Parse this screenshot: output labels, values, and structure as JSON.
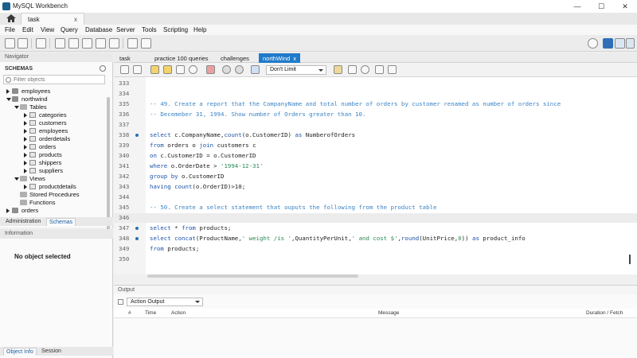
{
  "window": {
    "title": "MySQL Workbench",
    "controls": {
      "minimize": "—",
      "maximize": "☐",
      "close": "✕"
    }
  },
  "connection_tab": {
    "label": "task",
    "close": "x"
  },
  "menu": [
    "File",
    "Edit",
    "View",
    "Query",
    "Database",
    "Server",
    "Tools",
    "Scripting",
    "Help"
  ],
  "navigator": {
    "header": "Navigator",
    "schemas_title": "SCHEMAS",
    "filter_placeholder": "Filter objects",
    "tree": [
      {
        "label": "employees",
        "level": 0,
        "type": "db",
        "state": "collapsed"
      },
      {
        "label": "northwind",
        "level": 0,
        "type": "db",
        "state": "expanded"
      },
      {
        "label": "Tables",
        "level": 1,
        "type": "folder",
        "state": "expanded"
      },
      {
        "label": "categories",
        "level": 2,
        "type": "table",
        "state": "collapsed"
      },
      {
        "label": "customers",
        "level": 2,
        "type": "table",
        "state": "collapsed"
      },
      {
        "label": "employees",
        "level": 2,
        "type": "table",
        "state": "collapsed"
      },
      {
        "label": "orderdetails",
        "level": 2,
        "type": "table",
        "state": "collapsed"
      },
      {
        "label": "orders",
        "level": 2,
        "type": "table",
        "state": "collapsed"
      },
      {
        "label": "products",
        "level": 2,
        "type": "table",
        "state": "collapsed"
      },
      {
        "label": "shippers",
        "level": 2,
        "type": "table",
        "state": "collapsed"
      },
      {
        "label": "suppliers",
        "level": 2,
        "type": "table",
        "state": "collapsed"
      },
      {
        "label": "Views",
        "level": 1,
        "type": "folder",
        "state": "expanded"
      },
      {
        "label": "productdetails",
        "level": 2,
        "type": "table",
        "state": "collapsed"
      },
      {
        "label": "Stored Procedures",
        "level": 1,
        "type": "folder",
        "state": "none"
      },
      {
        "label": "Functions",
        "level": 1,
        "type": "folder",
        "state": "none"
      },
      {
        "label": "orders",
        "level": 0,
        "type": "db",
        "state": "collapsed"
      }
    ],
    "bottom_tabs": [
      "Administration",
      "Schemas"
    ]
  },
  "information": {
    "header": "Information",
    "message": "No object selected",
    "bottom_tabs": [
      "Object Info",
      "Session"
    ]
  },
  "editor_tabs": [
    {
      "label": "task",
      "active": false
    },
    {
      "label": "practice 100 queries",
      "active": false
    },
    {
      "label": "challenges",
      "active": false
    },
    {
      "label": "northWind",
      "active": true,
      "close": "x"
    }
  ],
  "sql_toolbar": {
    "limit": "Don't Limit"
  },
  "code_lines": [
    {
      "n": "333",
      "dot": false,
      "parts": []
    },
    {
      "n": "334",
      "dot": false,
      "parts": []
    },
    {
      "n": "335",
      "dot": false,
      "parts": [
        {
          "c": "cm",
          "t": "-- 49. Create a report that the CompanyName and total number of orders by customer renamed as number of orders since"
        }
      ]
    },
    {
      "n": "336",
      "dot": false,
      "parts": [
        {
          "c": "cm",
          "t": "-- Decemeber 31, 1994. Show number of Orders greater than 10."
        }
      ]
    },
    {
      "n": "337",
      "dot": false,
      "parts": []
    },
    {
      "n": "338",
      "dot": true,
      "parts": [
        {
          "c": "kw",
          "t": "select"
        },
        {
          "c": "",
          "t": " c.CompanyName,"
        },
        {
          "c": "kw",
          "t": "count"
        },
        {
          "c": "",
          "t": "(o.CustomerID) "
        },
        {
          "c": "kw",
          "t": "as"
        },
        {
          "c": "",
          "t": " NumberofOrders"
        }
      ]
    },
    {
      "n": "339",
      "dot": false,
      "parts": [
        {
          "c": "kw",
          "t": "from"
        },
        {
          "c": "",
          "t": " orders o "
        },
        {
          "c": "kw",
          "t": "join"
        },
        {
          "c": "",
          "t": " customers c"
        }
      ]
    },
    {
      "n": "340",
      "dot": false,
      "parts": [
        {
          "c": "kw",
          "t": "on"
        },
        {
          "c": "",
          "t": " c.CustomerID = o.CustomerID"
        }
      ]
    },
    {
      "n": "341",
      "dot": false,
      "parts": [
        {
          "c": "kw",
          "t": "where"
        },
        {
          "c": "",
          "t": " o.OrderDate > "
        },
        {
          "c": "st",
          "t": "'1994-12-31'"
        }
      ]
    },
    {
      "n": "342",
      "dot": false,
      "parts": [
        {
          "c": "kw",
          "t": "group by"
        },
        {
          "c": "",
          "t": " o.CustomerID"
        }
      ]
    },
    {
      "n": "343",
      "dot": false,
      "parts": [
        {
          "c": "kw",
          "t": "having"
        },
        {
          "c": "",
          "t": " "
        },
        {
          "c": "kw",
          "t": "count"
        },
        {
          "c": "",
          "t": "(o.OrderID)>10;"
        }
      ]
    },
    {
      "n": "344",
      "dot": false,
      "parts": []
    },
    {
      "n": "345",
      "dot": false,
      "parts": [
        {
          "c": "cm",
          "t": "-- 50. Create a select statement that ouputs the following from the product table"
        }
      ]
    },
    {
      "n": "346",
      "dot": false,
      "cursor": true,
      "parts": []
    },
    {
      "n": "347",
      "dot": true,
      "parts": [
        {
          "c": "kw",
          "t": "select"
        },
        {
          "c": "",
          "t": " * "
        },
        {
          "c": "kw",
          "t": "from"
        },
        {
          "c": "",
          "t": " products;"
        }
      ]
    },
    {
      "n": "348",
      "dot": true,
      "parts": [
        {
          "c": "kw",
          "t": "select"
        },
        {
          "c": "",
          "t": " "
        },
        {
          "c": "kw",
          "t": "concat"
        },
        {
          "c": "",
          "t": "(ProductName,"
        },
        {
          "c": "st",
          "t": "' weight /is '"
        },
        {
          "c": "",
          "t": ",QuantityPerUnit,"
        },
        {
          "c": "st",
          "t": "' and cost $'"
        },
        {
          "c": "",
          "t": ","
        },
        {
          "c": "kw",
          "t": "round"
        },
        {
          "c": "",
          "t": "(UnitPrice,"
        },
        {
          "c": "st",
          "t": "0"
        },
        {
          "c": "",
          "t": ")) "
        },
        {
          "c": "kw",
          "t": "as"
        },
        {
          "c": "",
          "t": " product_info"
        }
      ]
    },
    {
      "n": "349",
      "dot": false,
      "parts": [
        {
          "c": "kw",
          "t": "from"
        },
        {
          "c": "",
          "t": " products;"
        }
      ]
    },
    {
      "n": "350",
      "dot": false,
      "parts": []
    }
  ],
  "output": {
    "header": "Output",
    "selector": "Action Output",
    "columns": [
      "#",
      "Time",
      "Action",
      "Message",
      "Duration / Fetch"
    ]
  }
}
